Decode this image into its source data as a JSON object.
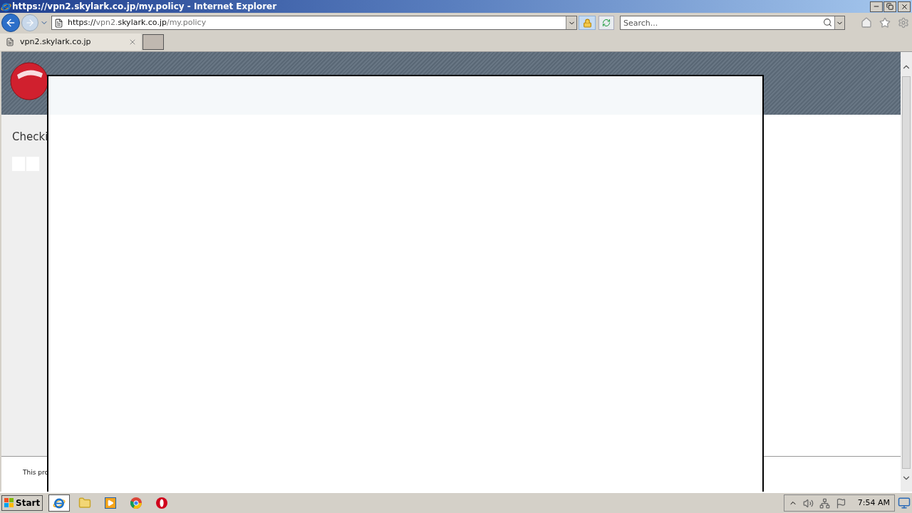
{
  "window": {
    "title": "https://vpn2.skylark.co.jp/my.policy - Internet Explorer"
  },
  "address_bar": {
    "segments": [
      {
        "text": "https://",
        "emphasized": true
      },
      {
        "text": "vpn2.",
        "emphasized": false
      },
      {
        "text": "skylark.co.jp",
        "emphasized": true
      },
      {
        "text": "/my.policy",
        "emphasized": false
      }
    ]
  },
  "search": {
    "placeholder": "Search..."
  },
  "tabs": [
    {
      "label": "vpn2.skylark.co.jp",
      "selected": true
    }
  ],
  "page": {
    "status": "Checki",
    "footer": "This pro"
  },
  "taskbar": {
    "start": "Start",
    "clock": "7:54 AM",
    "apps": [
      {
        "kind": "browser",
        "selected": true
      },
      {
        "kind": "folder",
        "selected": false
      },
      {
        "kind": "media",
        "selected": false
      },
      {
        "kind": "chrome",
        "selected": false
      },
      {
        "kind": "opera",
        "selected": false
      }
    ]
  }
}
